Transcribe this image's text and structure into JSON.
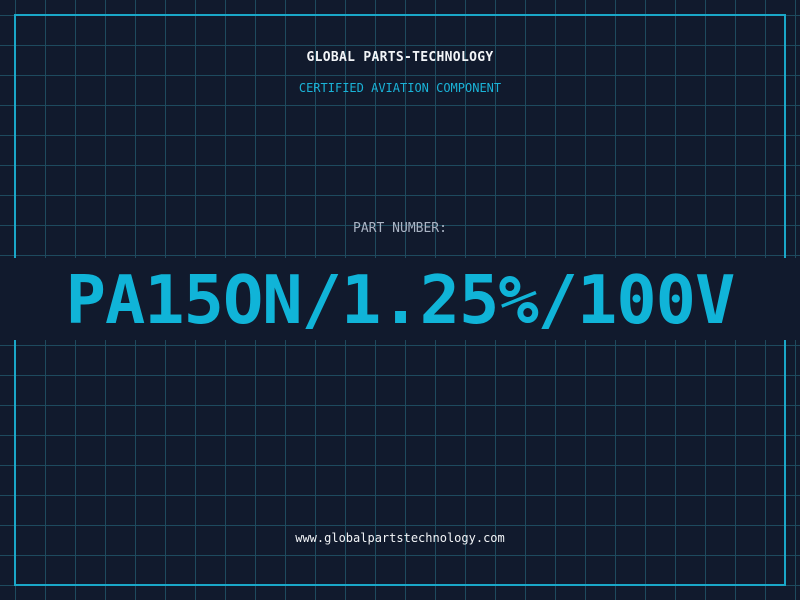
{
  "header": {
    "company": "GLOBAL PARTS-TECHNOLOGY",
    "tagline": "CERTIFIED AVIATION COMPONENT"
  },
  "part": {
    "label": "PART NUMBER:",
    "number": "PA15ON/1.25%/100V"
  },
  "footer": {
    "website": "www.globalpartstechnology.com"
  },
  "colors": {
    "background": "#111a2d",
    "grid": "#1e4a5e",
    "accent": "#10b4d8",
    "text": "#f2f4f7",
    "muted": "#aab4c4"
  }
}
